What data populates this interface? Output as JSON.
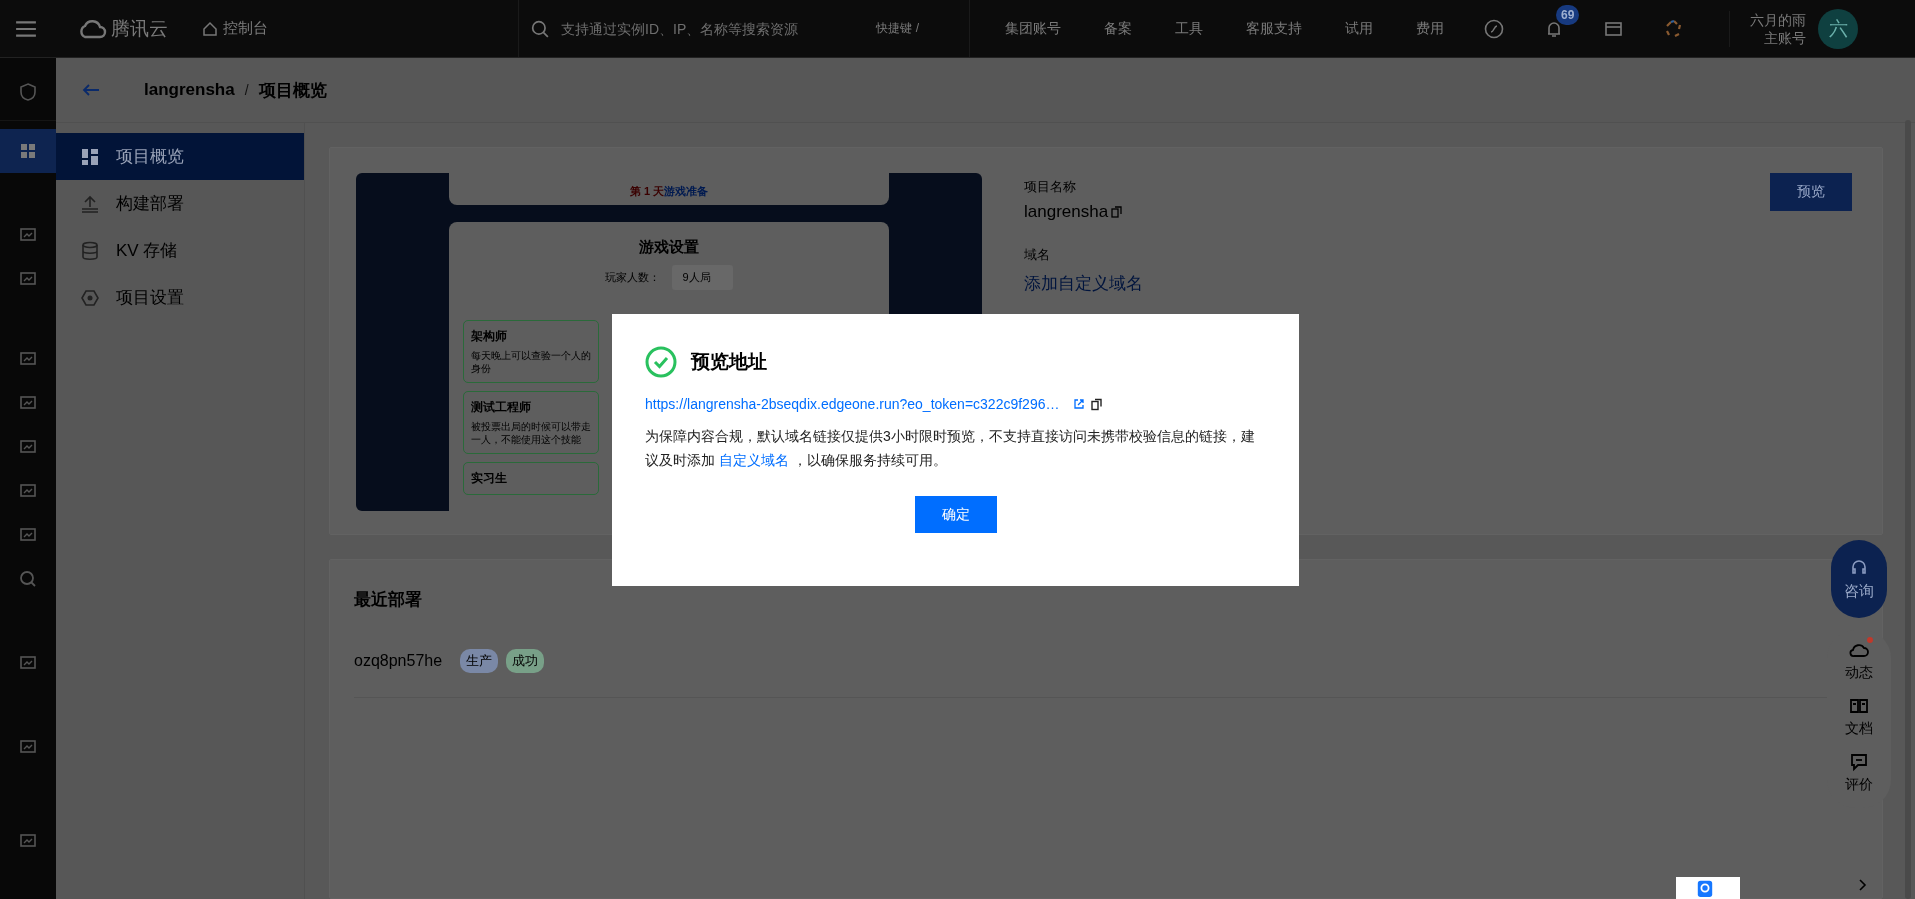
{
  "topbar": {
    "brand": "腾讯云",
    "console": "控制台",
    "search": {
      "placeholder": "支持通过实例ID、IP、名称等搜索资源"
    },
    "shortcut": "快捷键 /",
    "menu": [
      "集团账号",
      "备案",
      "工具",
      "客服支持",
      "试用",
      "费用"
    ],
    "notifications": "69",
    "user": {
      "name": "六月的雨",
      "role": "主账号",
      "avatar": "六"
    }
  },
  "icon_rail": [
    {
      "selected": false
    },
    {
      "selected": true
    },
    {
      "selected": false
    },
    {
      "selected": false
    },
    {
      "selected": false
    },
    {
      "selected": false
    },
    {
      "selected": false
    },
    {
      "selected": false
    },
    {
      "selected": false
    },
    {
      "selected": false
    },
    {
      "selected": false
    },
    {
      "selected": false
    },
    {
      "selected": false
    }
  ],
  "breadcrumb": {
    "project": "langrensha",
    "separator": "/",
    "page": "项目概览"
  },
  "sidebar": {
    "items": [
      {
        "label": "项目概览",
        "selected": true
      },
      {
        "label": "构建部署",
        "selected": false
      },
      {
        "label": "KV 存储",
        "selected": false
      },
      {
        "label": "项目设置",
        "selected": false
      }
    ]
  },
  "project": {
    "preview_shot": {
      "day": "第 1 天",
      "phase": "游戏准备",
      "settings_title": "游戏设置",
      "players_label": "玩家人数：",
      "players_value": "9人局",
      "roles": [
        {
          "name": "架构师",
          "desc": "每天晚上可以查验一个人的身份"
        },
        {
          "name": "测试工程师",
          "desc": "被投票出局的时候可以带走一人，不能使用这个技能"
        },
        {
          "name": "实习生"
        }
      ]
    },
    "name_label": "项目名称",
    "name": "langrensha",
    "domain_label": "域名",
    "domain_link": "添加自定义域名",
    "preview_button": "预览"
  },
  "recent": {
    "title": "最近部署",
    "rows": [
      {
        "id": "ozq8pn57he",
        "tags": [
          {
            "label": "生产",
            "color": "#7a88a6"
          },
          {
            "label": "成功",
            "color": "#78a088"
          }
        ]
      }
    ]
  },
  "float_panel": {
    "consult": "咨询",
    "items": [
      {
        "label": "动态",
        "dot": true
      },
      {
        "label": "文档",
        "dot": false
      },
      {
        "label": "评价",
        "dot": false
      }
    ]
  },
  "modal": {
    "title": "预览地址",
    "url": "https://langrensha-2bseqdix.edgeone.run?eo_token=c322c9f296…",
    "notice": {
      "before": "为保障内容合规，默认域名链接仅提供3小时限时预览，不支持直接访问未携带校验信息的链接，建议及时添加 ",
      "link": "自定义域名",
      "after": " ，以确保服务持续可用。"
    },
    "ok": "确定"
  }
}
